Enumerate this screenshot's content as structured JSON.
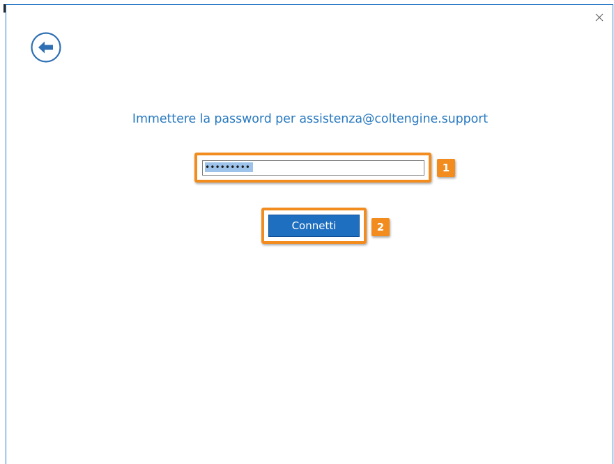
{
  "dialog": {
    "prompt_text": "Immettere la password per assistenza@coltengine.support",
    "password_field": {
      "masked_value": "•••••••••",
      "selected": true
    },
    "connect_button_label": "Connetti"
  },
  "annotations": {
    "badge_1": "1",
    "badge_2": "2"
  },
  "icons": {
    "back": "back-arrow-circle-icon",
    "close": "close-x-icon"
  },
  "colors": {
    "accent": "#2a7ac0",
    "button_bg": "#1e6fc0",
    "highlight": "#f28c1e",
    "selection": "#9ec3ea"
  }
}
